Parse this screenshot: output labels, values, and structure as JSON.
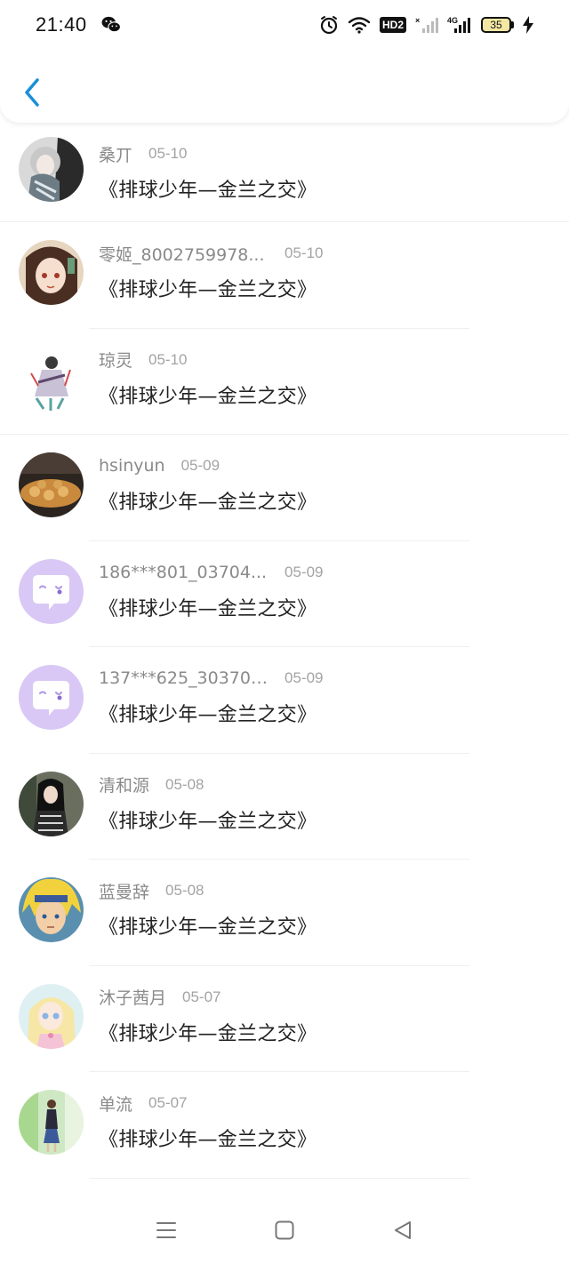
{
  "status_bar": {
    "time": "21:40",
    "hd_label": "HD2",
    "network_label": "4G",
    "battery_level": "35"
  },
  "nav": {
    "back_icon": "chevron-left-icon",
    "accent": "#1a8fd8"
  },
  "list": [
    {
      "username": "桑丌",
      "date": "05-10",
      "message": "《排球少年—金兰之交》",
      "avatar": "avatar-grey-hair"
    },
    {
      "username": "零姬_8002759978...",
      "date": "05-10",
      "message": "《排球少年—金兰之交》",
      "avatar": "avatar-anime-girl"
    },
    {
      "username": "琼灵",
      "date": "05-10",
      "message": "《排球少年—金兰之交》",
      "avatar": "avatar-figure"
    },
    {
      "username": "hsinyun",
      "date": "05-09",
      "message": "《排球少年—金兰之交》",
      "avatar": "avatar-food"
    },
    {
      "username": "186***801_03704...",
      "date": "05-09",
      "message": "《排球少年—金兰之交》",
      "avatar": "avatar-default-chat"
    },
    {
      "username": "137***625_303702...",
      "date": "05-09",
      "message": "《排球少年—金兰之交》",
      "avatar": "avatar-default-chat"
    },
    {
      "username": "清和源",
      "date": "05-08",
      "message": "《排球少年—金兰之交》",
      "avatar": "avatar-photo-girl"
    },
    {
      "username": "蓝曼辞",
      "date": "05-08",
      "message": "《排球少年—金兰之交》",
      "avatar": "avatar-anime-blond"
    },
    {
      "username": "沐子茜月",
      "date": "05-07",
      "message": "《排球少年—金兰之交》",
      "avatar": "avatar-pastel-girl"
    },
    {
      "username": "单流",
      "date": "05-07",
      "message": "《排球少年—金兰之交》",
      "avatar": "avatar-fashion"
    }
  ],
  "system_nav": {
    "menu_icon": "menu-icon",
    "home_icon": "home-square-icon",
    "back_icon": "back-triangle-icon"
  }
}
